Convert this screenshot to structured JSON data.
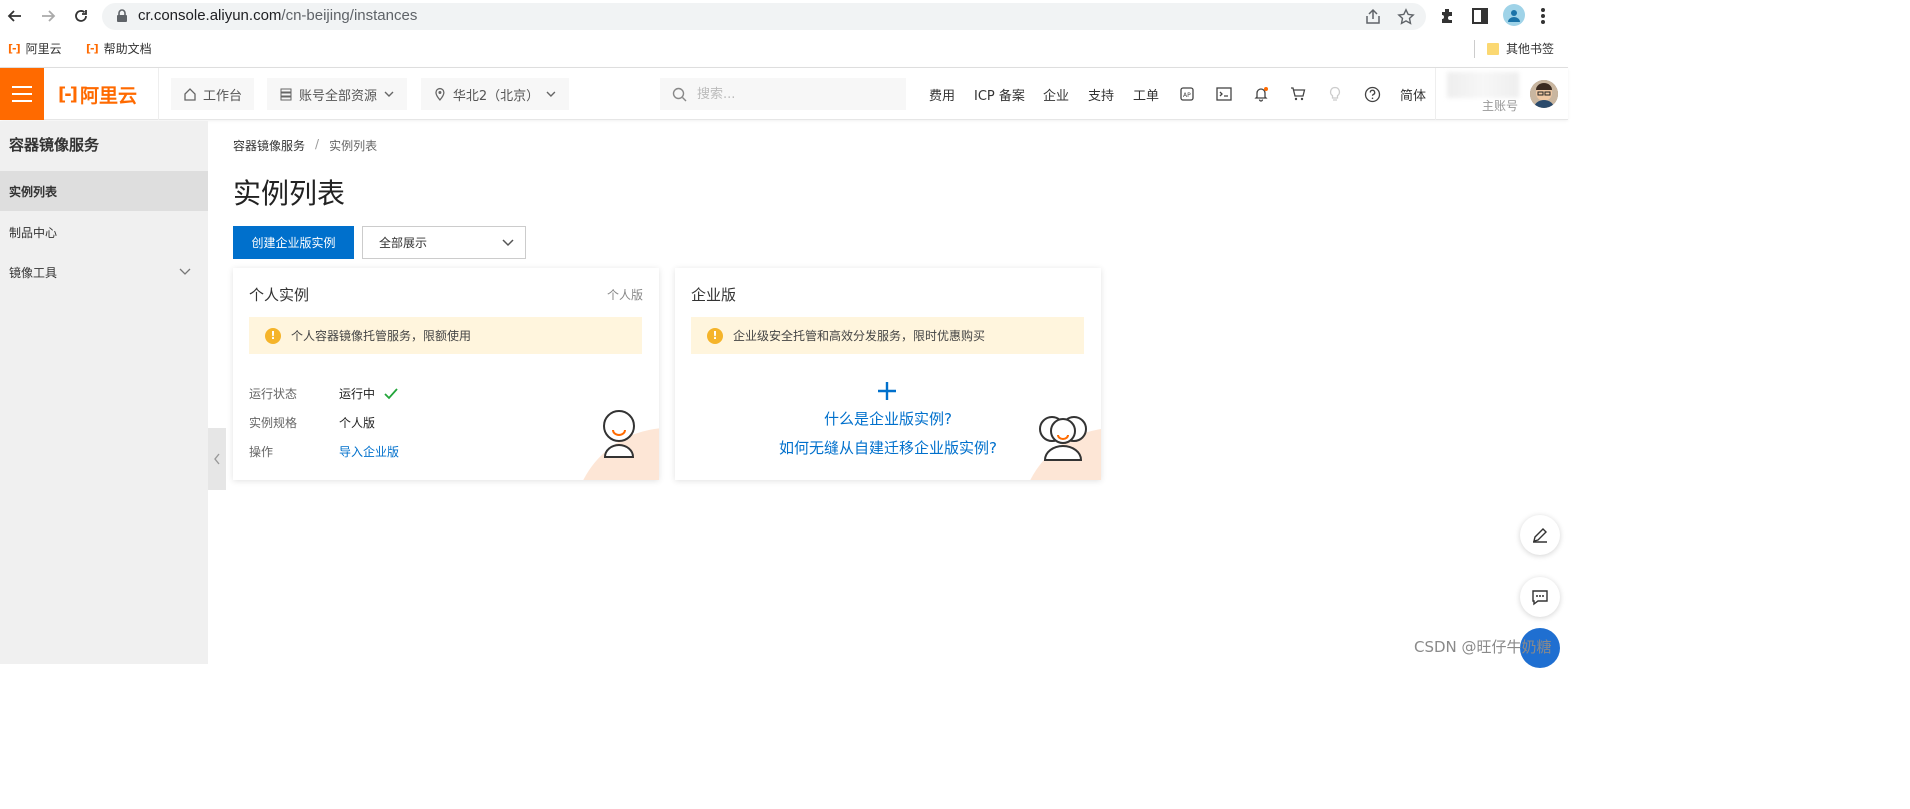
{
  "browser": {
    "url_domain": "cr.console.aliyun.com",
    "url_path": "/cn-beijing/instances",
    "bookmarks": [
      {
        "label": "阿里云"
      },
      {
        "label": "帮助文档"
      }
    ],
    "other_bookmarks": "其他书签"
  },
  "topbar": {
    "logo": "阿里云",
    "workbench": "工作台",
    "resources": "账号全部资源",
    "region": "华北2（北京）",
    "search_placeholder": "搜索...",
    "links": [
      "费用",
      "ICP 备案",
      "企业",
      "支持",
      "工单"
    ],
    "language": "简体",
    "account_type": "主账号"
  },
  "sidebar": {
    "title": "容器镜像服务",
    "items": [
      {
        "label": "实例列表",
        "active": true
      },
      {
        "label": "制品中心",
        "active": false
      },
      {
        "label": "镜像工具",
        "active": false
      }
    ]
  },
  "breadcrumb": {
    "root": "容器镜像服务",
    "separator": "/",
    "current": "实例列表"
  },
  "page": {
    "title": "实例列表",
    "create_button": "创建企业版实例",
    "filter_value": "全部展示"
  },
  "personal_card": {
    "title": "个人实例",
    "tag": "个人版",
    "notice": "个人容器镜像托管服务，限额使用",
    "fields": [
      {
        "label": "运行状态",
        "value": "运行中"
      },
      {
        "label": "实例规格",
        "value": "个人版"
      },
      {
        "label": "操作",
        "value": "导入企业版"
      }
    ]
  },
  "enterprise_card": {
    "title": "企业版",
    "notice": "企业级安全托管和高效分发服务，限时优惠购买",
    "link1": "什么是企业版实例?",
    "link2": "如何无缝从自建迁移企业版实例?"
  },
  "watermark": "CSDN @旺仔牛奶糖",
  "colors": {
    "brand": "#ff6a00",
    "primary": "#0070cc",
    "notice_bg": "#fff5dd",
    "warning": "#f5b42a",
    "success": "#23a53a"
  }
}
